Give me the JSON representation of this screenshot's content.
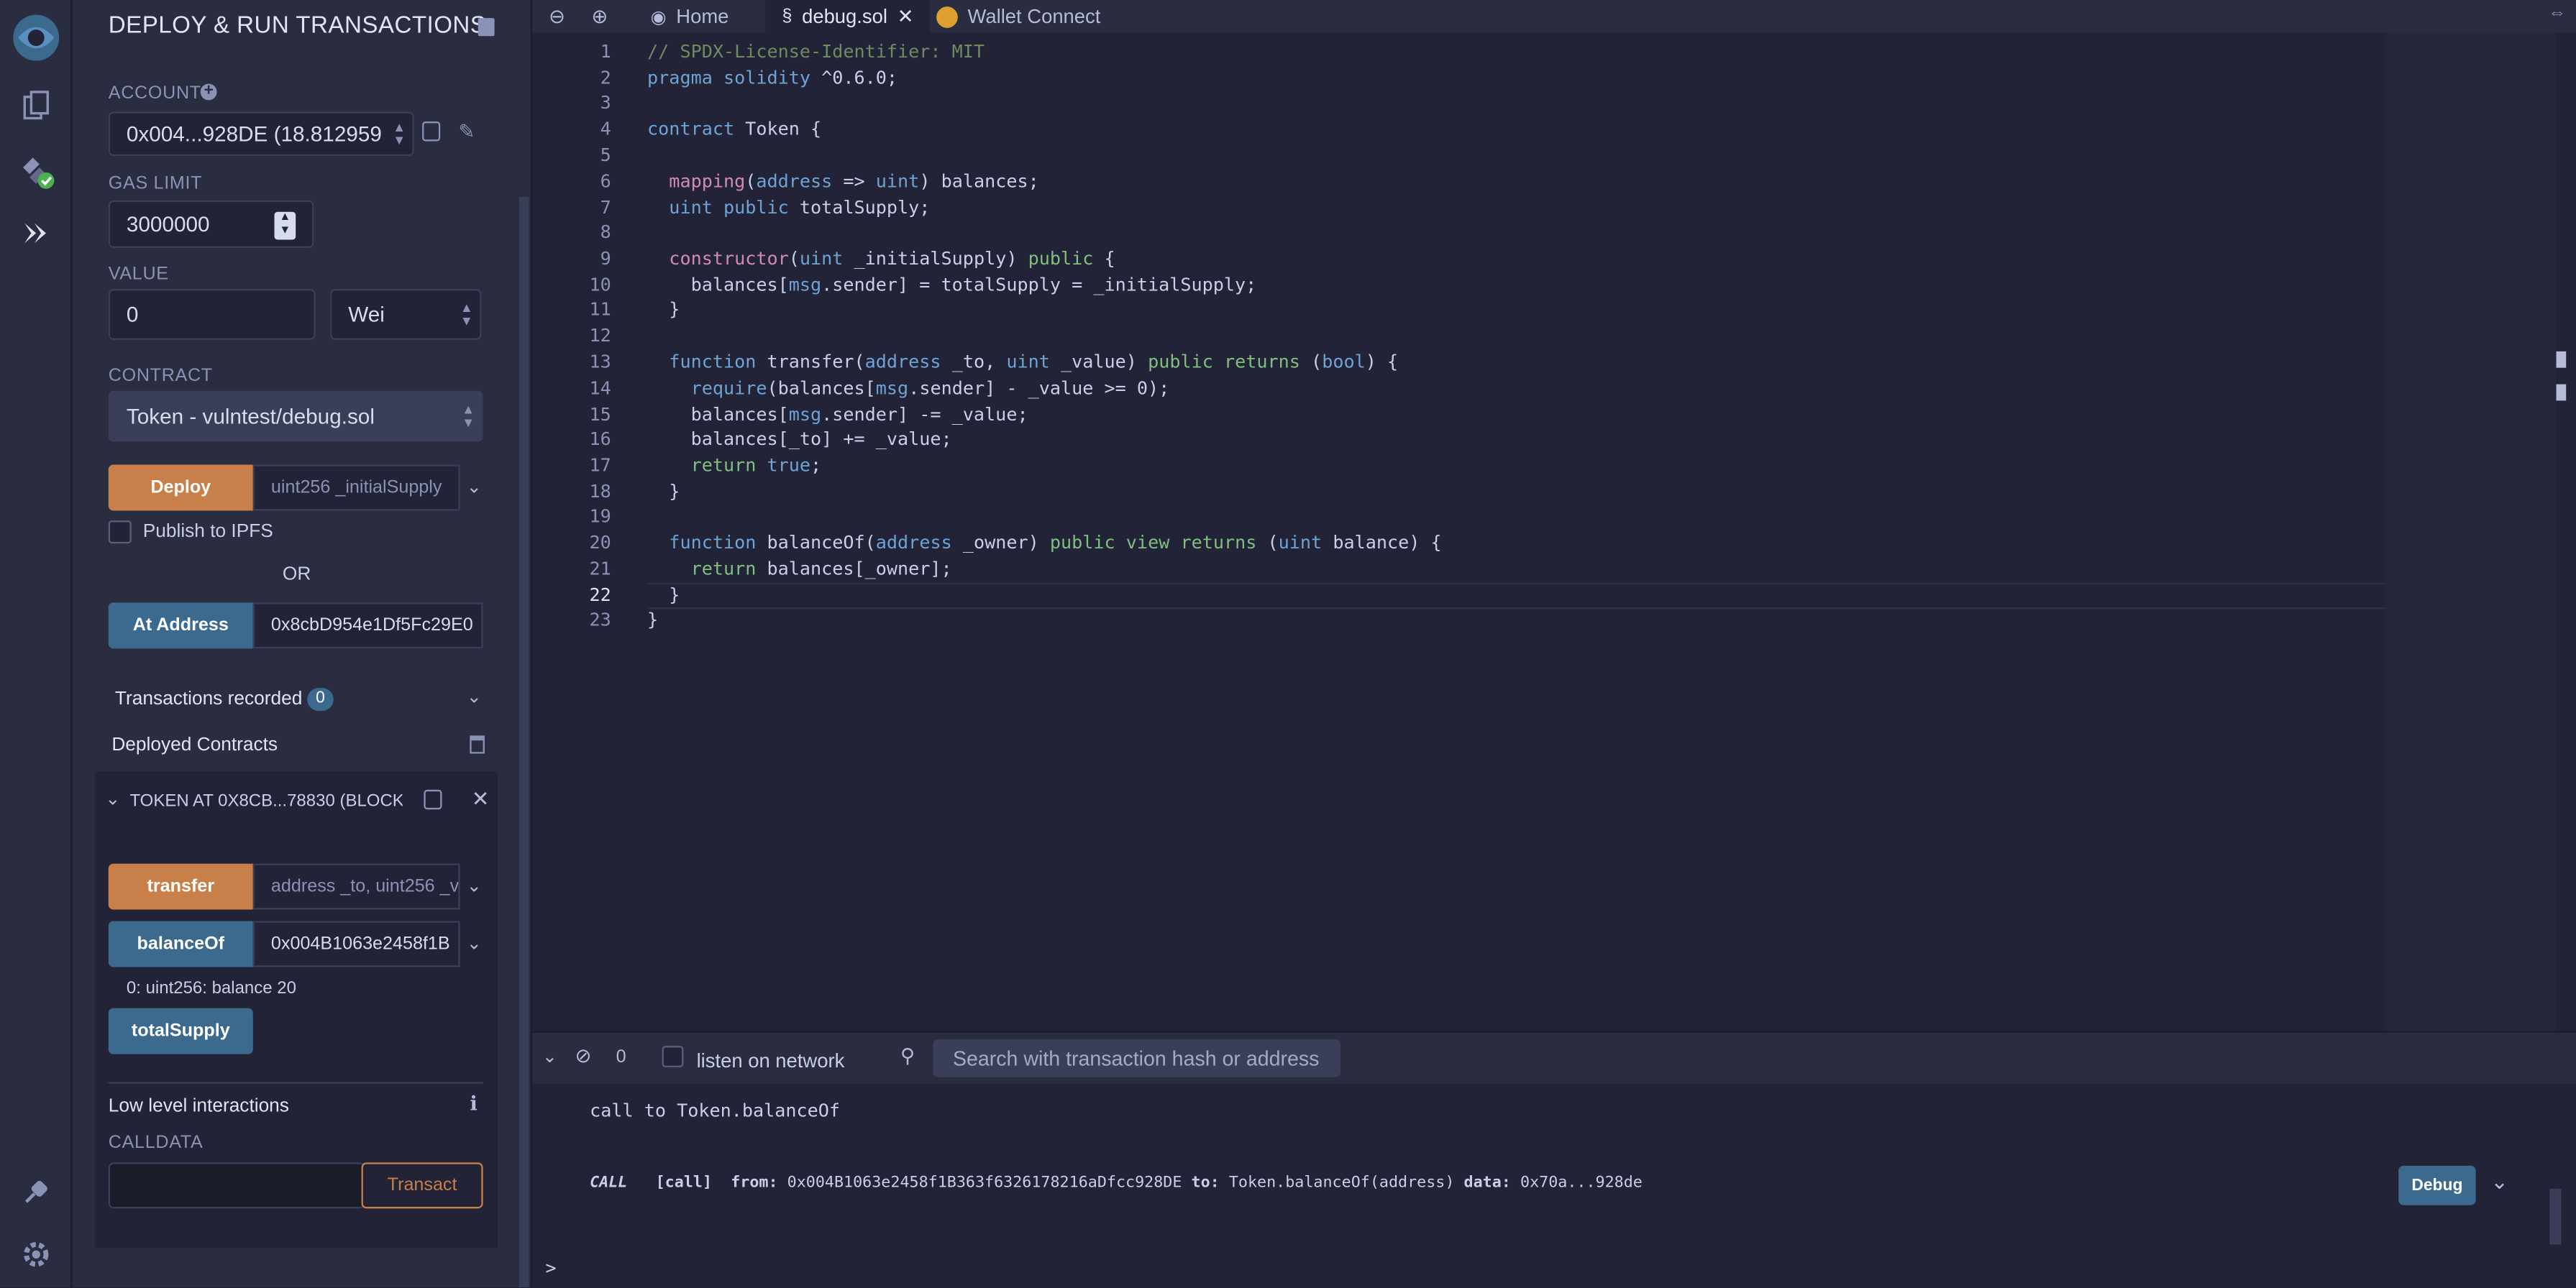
{
  "panel": {
    "title": "DEPLOY & RUN TRANSACTIONS",
    "account_label": "ACCOUNT",
    "account_value": "0x004...928DE (18.812959",
    "gas_limit_label": "GAS LIMIT",
    "gas_limit_value": "3000000",
    "value_label": "VALUE",
    "value_amount": "0",
    "value_unit": "Wei",
    "contract_label": "CONTRACT",
    "contract_value": "Token - vulntest/debug.sol",
    "deploy_label": "Deploy",
    "deploy_placeholder": "uint256 _initialSupply",
    "publish_label": "Publish to IPFS",
    "or_label": "OR",
    "at_address_label": "At Address",
    "at_address_value": "0x8cbD954e1Df5Fc29E0",
    "transactions_recorded_label": "Transactions recorded",
    "transactions_recorded_count": "0",
    "deployed_contracts_label": "Deployed Contracts",
    "instance_title": "TOKEN AT 0X8CB...78830 (BLOCK",
    "transfer_label": "transfer",
    "transfer_placeholder": "address _to, uint256 _v",
    "balanceof_label": "balanceOf",
    "balanceof_value": "0x004B1063e2458f1B",
    "balanceof_result": "0: uint256: balance 20",
    "totalsupply_label": "totalSupply",
    "low_level_label": "Low level interactions",
    "calldata_label": "CALLDATA",
    "transact_label": "Transact"
  },
  "tabs": [
    {
      "label": "Home"
    },
    {
      "label": "debug.sol"
    },
    {
      "label": "Wallet Connect"
    }
  ],
  "editor": {
    "lines": [
      "1",
      "2",
      "3",
      "4",
      "5",
      "6",
      "7",
      "8",
      "9",
      "10",
      "11",
      "12",
      "13",
      "14",
      "15",
      "16",
      "17",
      "18",
      "19",
      "20",
      "21",
      "22",
      "23"
    ],
    "code": {
      "l1": "// SPDX-License-Identifier: MIT",
      "l2a": "pragma solidity",
      "l2b": " ^0.6.0;",
      "l4a": "contract",
      "l4b": " Token {",
      "l6a": "  mapping",
      "l6b": "(",
      "l6c": "address",
      "l6d": " => ",
      "l6e": "uint",
      "l6f": ") balances;",
      "l7a": "  uint",
      "l7b": " public",
      "l7c": " totalSupply;",
      "l9a": "  constructor",
      "l9b": "(",
      "l9c": "uint",
      "l9d": " _initialSupply) ",
      "l9e": "public",
      "l9f": " {",
      "l10a": "    balances[",
      "l10b": "msg",
      "l10c": ".sender] = totalSupply = _initialSupply;",
      "l11": "  }",
      "l13a": "  function",
      "l13b": " transfer(",
      "l13c": "address",
      "l13d": " _to, ",
      "l13e": "uint",
      "l13f": " _value) ",
      "l13g": "public",
      "l13h": " returns",
      "l13i": " (",
      "l13j": "bool",
      "l13k": ") {",
      "l14a": "    require",
      "l14b": "(balances[",
      "l14c": "msg",
      "l14d": ".sender] - _value >= 0);",
      "l15a": "    balances[",
      "l15b": "msg",
      "l15c": ".sender] -= _value;",
      "l16": "    balances[_to] += _value;",
      "l17a": "    return",
      "l17b": " true",
      "l17c": ";",
      "l18": "  }",
      "l20a": "  function",
      "l20b": " balanceOf(",
      "l20c": "address",
      "l20d": " _owner) ",
      "l20e": "public",
      "l20f": " view",
      "l20g": " returns",
      "l20h": " (",
      "l20i": "uint",
      "l20j": " balance) {",
      "l21a": "    return",
      "l21b": " balances[_owner];",
      "l22": "  }",
      "l23": "}"
    }
  },
  "terminal": {
    "pending_count": "0",
    "listen_label": "listen on network",
    "search_placeholder": "Search with transaction hash or address",
    "call_msg": "call to Token.balanceOf",
    "call_tag": "CALL",
    "call_detail_a": "[call]",
    "from_label": "from:",
    "from_value": "0x004B1063e2458f1B363f6326178216aDfcc928DE",
    "to_label": "to:",
    "to_value": "Token.balanceOf(address)",
    "data_label": "data:",
    "data_value": "0x70a...928de",
    "debug_label": "Debug",
    "prompt": ">"
  },
  "colors": {
    "accent_orange": "#c97f4a",
    "accent_blue": "#3c6a8f",
    "bg": "#222336",
    "panel": "#2a2c3f"
  }
}
